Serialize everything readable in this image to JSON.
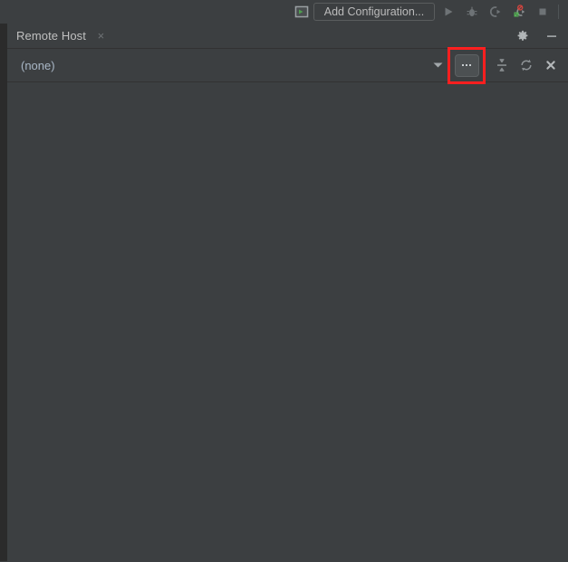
{
  "ide_toolbar": {
    "run_widget_icon": "run-widget-icon",
    "add_configuration_label": "Add Configuration...",
    "actions": [
      {
        "name": "run-icon",
        "title": "Run"
      },
      {
        "name": "debug-icon",
        "title": "Debug"
      },
      {
        "name": "run-with-coverage-icon",
        "title": "Run with Coverage"
      },
      {
        "name": "profile-disabled-icon",
        "title": "Profile"
      },
      {
        "name": "stop-icon",
        "title": "Stop"
      }
    ],
    "colors": {
      "background": "#3c3f41",
      "icon": "#6e7376",
      "green_accent": "#4a9f4a",
      "red_accent": "#d0453f",
      "button_border": "#5a5d5e",
      "text": "#bbbbbb"
    }
  },
  "tool_window": {
    "tab": {
      "label": "Remote Host",
      "close_glyph": "×",
      "close_name": "tab-close-icon"
    },
    "header_actions": [
      {
        "name": "settings-gear-icon",
        "title": "Settings"
      },
      {
        "name": "hide-minimize-icon",
        "title": "Hide"
      }
    ],
    "toolbar": {
      "host_select_value": "(none)",
      "host_select_placeholder": "(none)",
      "chevron_glyph": "▾",
      "browse_button": {
        "name": "browse-ellipsis-button",
        "label": "...",
        "highlighted": true,
        "highlight_color": "#ff1f1f"
      },
      "actions": [
        {
          "name": "collapse-all-icon",
          "title": "Collapse All"
        },
        {
          "name": "refresh-icon",
          "title": "Refresh"
        },
        {
          "name": "close-panel-icon",
          "title": "Close"
        }
      ]
    }
  },
  "colors": {
    "panel_background": "#3c3f41",
    "gutter_background": "#2b2b2b",
    "separator": "#323232",
    "text_primary": "#c0c0c0",
    "text_value": "#a9b7c6",
    "icon_muted": "#6f7376"
  }
}
